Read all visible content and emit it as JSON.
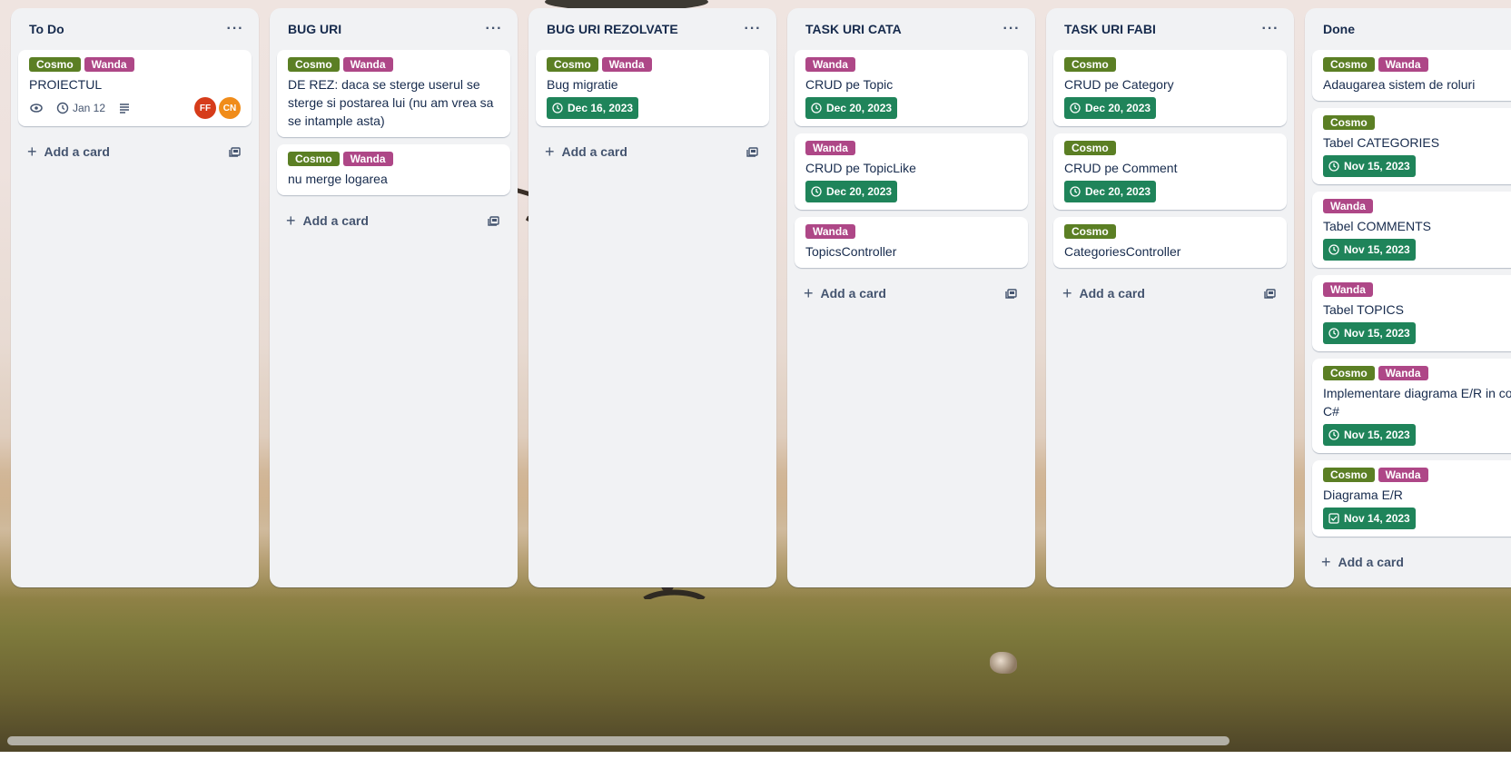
{
  "colors": {
    "label_green": "#5b7f24",
    "label_pink": "#ae4787",
    "due_green": "#1f845a"
  },
  "lists": [
    {
      "title": "To Do",
      "add_label": "Add a card",
      "cards": [
        {
          "labels": [
            "Cosmo",
            "Wanda"
          ],
          "title": "PROIECTUL",
          "date": "Jan 12",
          "members": [
            "FF",
            "CN"
          ]
        }
      ]
    },
    {
      "title": "BUG URI",
      "add_label": "Add a card",
      "cards": [
        {
          "labels": [
            "Cosmo",
            "Wanda"
          ],
          "title": "DE REZ: daca se sterge userul se sterge si postarea lui (nu am vrea sa se intample asta)"
        },
        {
          "labels": [
            "Cosmo",
            "Wanda"
          ],
          "title": "nu merge logarea"
        }
      ]
    },
    {
      "title": "BUG URI REZOLVATE",
      "add_label": "Add a card",
      "cards": [
        {
          "labels": [
            "Cosmo",
            "Wanda"
          ],
          "title": "Bug migratie",
          "due": "Dec 16, 2023"
        }
      ]
    },
    {
      "title": "TASK URI CATA",
      "add_label": "Add a card",
      "cards": [
        {
          "labels": [
            "Wanda"
          ],
          "title": "CRUD pe Topic",
          "due": "Dec 20, 2023"
        },
        {
          "labels": [
            "Wanda"
          ],
          "title": "CRUD pe TopicLike",
          "due": "Dec 20, 2023"
        },
        {
          "labels": [
            "Wanda"
          ],
          "title": "TopicsController"
        }
      ]
    },
    {
      "title": "TASK URI FABI",
      "add_label": "Add a card",
      "cards": [
        {
          "labels": [
            "Cosmo"
          ],
          "title": "CRUD pe Category",
          "due": "Dec 20, 2023"
        },
        {
          "labels": [
            "Cosmo"
          ],
          "title": "CRUD pe Comment",
          "due": "Dec 20, 2023"
        },
        {
          "labels": [
            "Cosmo"
          ],
          "title": "CategoriesController"
        }
      ]
    },
    {
      "title": "Done",
      "add_label": "Add a card",
      "cards": [
        {
          "labels": [
            "Cosmo",
            "Wanda"
          ],
          "title": "Adaugarea sistem de roluri"
        },
        {
          "labels": [
            "Cosmo"
          ],
          "title": "Tabel CATEGORIES",
          "due": "Nov 15, 2023"
        },
        {
          "labels": [
            "Wanda"
          ],
          "title": "Tabel COMMENTS",
          "due": "Nov 15, 2023"
        },
        {
          "labels": [
            "Wanda"
          ],
          "title": "Tabel TOPICS",
          "due": "Nov 15, 2023"
        },
        {
          "labels": [
            "Cosmo",
            "Wanda"
          ],
          "title": "Implementare diagrama E/R in cod C#",
          "due": "Nov 15, 2023"
        },
        {
          "labels": [
            "Cosmo",
            "Wanda"
          ],
          "title": "Diagrama E/R",
          "due": "Nov 14, 2023",
          "due_icon": "checkbox-icon"
        }
      ]
    }
  ]
}
